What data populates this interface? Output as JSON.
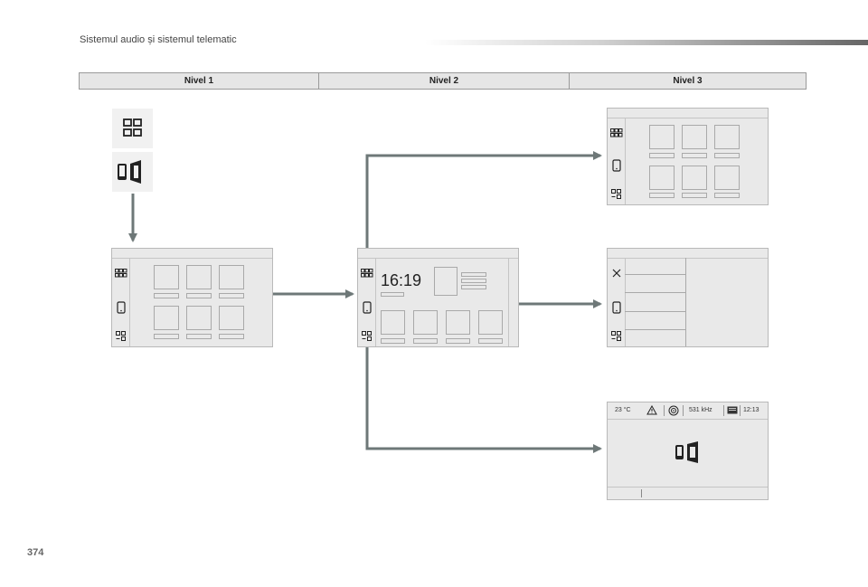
{
  "header": {
    "title": "Sistemul audio și sistemul telematic"
  },
  "levels": [
    {
      "label": "Nivel 1"
    },
    {
      "label": "Nivel 2"
    },
    {
      "label": "Nivel 3"
    }
  ],
  "home_screen": {
    "clock": "16:19"
  },
  "status_bar": {
    "temperature": "23 °C",
    "frequency": "531 kHz",
    "time": "12:13"
  },
  "icons": [
    "apps-grid-icon",
    "mirror-screen-icon",
    "phone-icon",
    "settings-grid-icon",
    "close-icon",
    "warning-icon",
    "radio-icon"
  ],
  "colors": {
    "arrow": "#6e7878",
    "screen": "#e9e9e9",
    "border": "#b9b9b9"
  },
  "footer": {
    "page_number": "374"
  }
}
